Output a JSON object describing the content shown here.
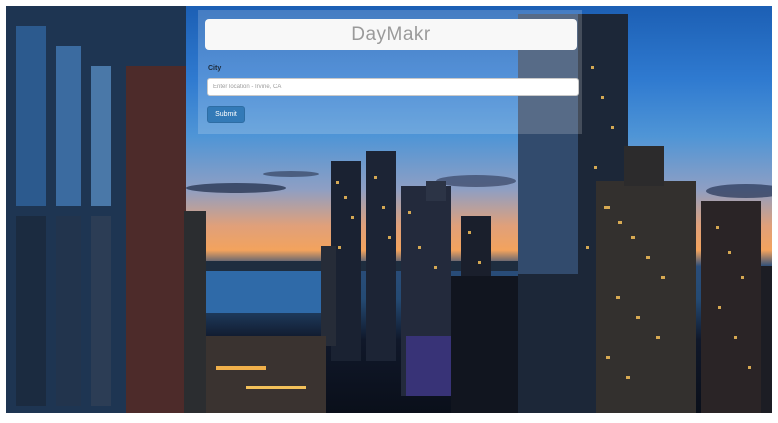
{
  "app": {
    "title": "DayMakr"
  },
  "form": {
    "city_label": "City",
    "city_placeholder": "Enter location - Irvine, CA",
    "city_value": "",
    "submit_label": "Submit"
  },
  "background": {
    "description_icon": "city-skyline-photo"
  },
  "colors": {
    "accent": "#337ab7",
    "title_text": "#9a9a9a"
  }
}
